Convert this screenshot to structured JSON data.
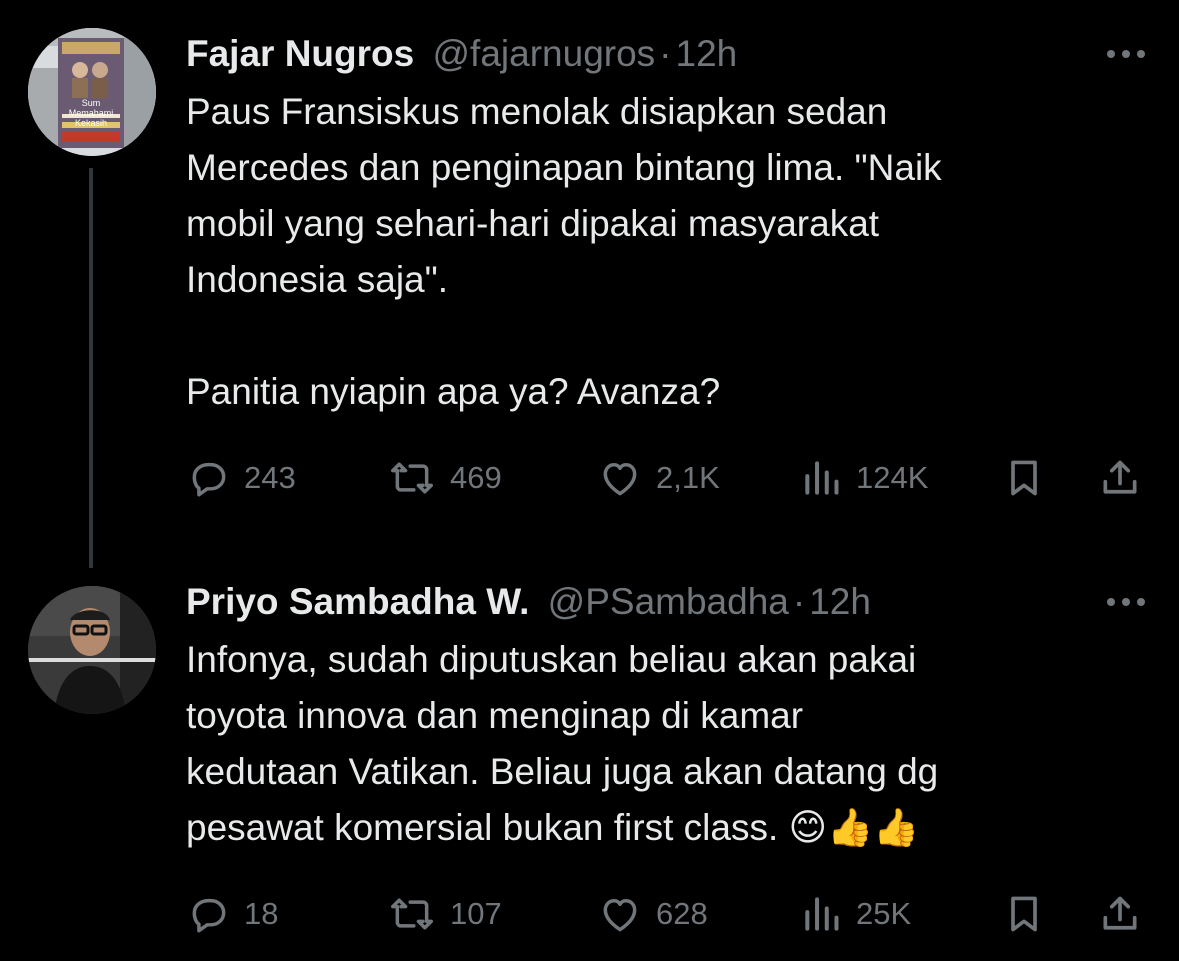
{
  "tweets": [
    {
      "author_name": "Fajar Nugros",
      "handle": "@fajarnugros",
      "separator": "·",
      "time": "12h",
      "avatar_icon": "billboard-photo",
      "avatar_caption": "Sum Memahami Kekasih",
      "text": "Paus Fransiskus menolak disiapkan sedan\nMercedes dan penginapan bintang lima. \"Naik\nmobil yang sehari-hari dipakai masyarakat\nIndonesia saja\".\n\nPanitia nyiapin apa ya? Avanza?",
      "replies": "243",
      "reposts": "469",
      "likes": "2,1K",
      "views": "124K"
    },
    {
      "author_name": "Priyo Sambadha W.",
      "handle": "@PSambadha",
      "separator": "·",
      "time": "12h",
      "avatar_icon": "man-with-glasses-photo",
      "text": "Infonya, sudah diputuskan beliau akan pakai\ntoyota innova dan menginap di kamar\nkedutaan Vatikan. Beliau juga akan datang dg\npesawat komersial bukan first class. 😊👍👍",
      "replies": "18",
      "reposts": "107",
      "likes": "628",
      "views": "25K"
    }
  ],
  "colors": {
    "background": "#000000",
    "text_primary": "#e7e9ea",
    "text_secondary": "#71767b",
    "thread_line": "#333639"
  },
  "icons": [
    "more-icon",
    "reply-icon",
    "repost-icon",
    "like-icon",
    "views-icon",
    "bookmark-icon",
    "share-icon"
  ]
}
